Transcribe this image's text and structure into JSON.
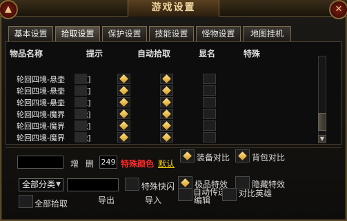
{
  "window": {
    "title": "游戏设置",
    "left_button": "▲",
    "right_button": "✕"
  },
  "tabs": [
    {
      "label": "基本设置",
      "active": false
    },
    {
      "label": "拾取设置",
      "active": true
    },
    {
      "label": "保护设置",
      "active": false
    },
    {
      "label": "技能设置",
      "active": false
    },
    {
      "label": "怪物设置",
      "active": false
    },
    {
      "label": "地图挂机",
      "active": false
    }
  ],
  "table": {
    "headers": [
      "物品名称",
      "提示",
      "自动拾取",
      "显名",
      "特殊"
    ],
    "rows": [
      {
        "name_prefix": "轮回四境-悬壶",
        "name_suffix": "[道]",
        "hint": true,
        "auto_pick": true,
        "show_name": false
      },
      {
        "name_prefix": "轮回四境-悬壶",
        "name_suffix": "[道]",
        "hint": true,
        "auto_pick": true,
        "show_name": false
      },
      {
        "name_prefix": "轮回四境-悬壶",
        "name_suffix": "[道]",
        "hint": true,
        "auto_pick": true,
        "show_name": false
      },
      {
        "name_prefix": "轮回四境-魔界",
        "name_suffix": "[战]",
        "hint": true,
        "auto_pick": true,
        "show_name": false
      },
      {
        "name_prefix": "轮回四境-魔界",
        "name_suffix": "[战]",
        "hint": true,
        "auto_pick": true,
        "show_name": false
      },
      {
        "name_prefix": "轮回四境-魔界",
        "name_suffix": "[战]",
        "hint": true,
        "auto_pick": true,
        "show_name": false
      }
    ]
  },
  "controls": {
    "add_label": "增",
    "delete_label": "删",
    "count_value": "249",
    "special_color_label": "特殊颜色",
    "default_label": "默认",
    "equip_compare_label": "装备对比",
    "bag_compare_label": "背包对比",
    "category_select": "全部分类",
    "export_label": "导出",
    "special_shortcut_label": "特殊快闪",
    "import_label": "导入",
    "extreme_effect_label": "极品特效",
    "auto_teleport_label": "自动传送",
    "edit_label": "编辑",
    "hidden_effect_label": "隐藏特效",
    "compare_hero_label": "对比英雄",
    "pick_all_label": "全部拾取"
  },
  "colors": {
    "accent_gold": "#d59b1f",
    "special_red": "#ff2a2a",
    "default_yellow": "#f0d000"
  }
}
